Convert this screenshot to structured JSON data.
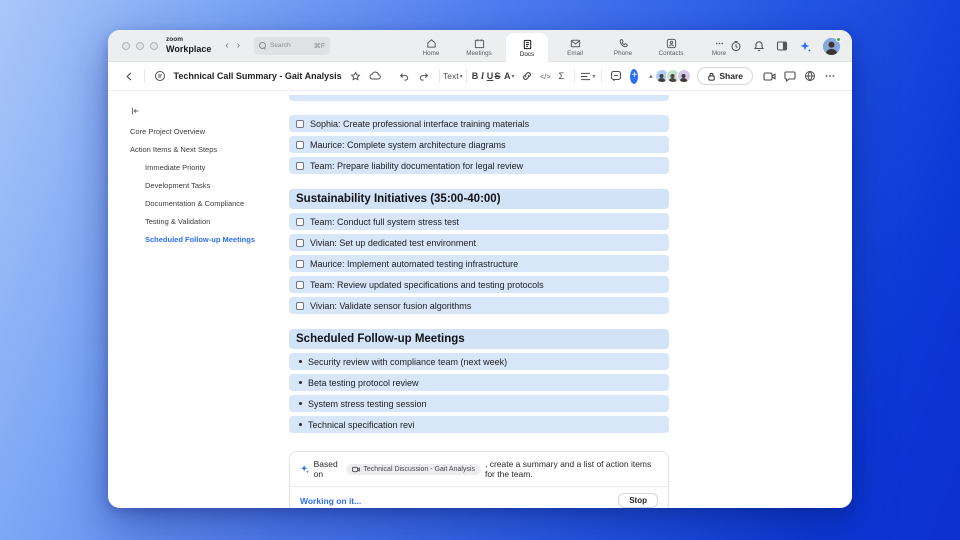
{
  "topbar": {
    "logo": {
      "line1": "zoom",
      "line2": "Workplace"
    },
    "search": {
      "placeholder": "Search",
      "shortcut": "⌘F"
    },
    "nav": [
      {
        "label": "Home"
      },
      {
        "label": "Meetings"
      },
      {
        "label": "Docs"
      },
      {
        "label": "Email"
      },
      {
        "label": "Phone"
      },
      {
        "label": "Contacts"
      },
      {
        "label": "More"
      }
    ]
  },
  "doc_toolbar": {
    "title": "Technical Call Summary - Gait Analysis",
    "text_dropdown": "Text",
    "bold": "B",
    "italic": "I",
    "underline": "U",
    "strike": "S",
    "color": "A",
    "code": "</>",
    "sigma": "Σ",
    "share_label": "Share"
  },
  "outline": {
    "items": [
      {
        "label": "Core Project Overview",
        "level": 1,
        "active": false
      },
      {
        "label": "Action Items & Next Steps",
        "level": 1,
        "active": false
      },
      {
        "label": "Immediate Priority",
        "level": 2,
        "active": false
      },
      {
        "label": "Development Tasks",
        "level": 2,
        "active": false
      },
      {
        "label": "Documentation & Compliance",
        "level": 2,
        "active": false
      },
      {
        "label": "Testing & Validation",
        "level": 2,
        "active": false
      },
      {
        "label": "Scheduled Follow-up Meetings",
        "level": 2,
        "active": true
      }
    ]
  },
  "document": {
    "checklist_top": {
      "items": [
        "Sophia: Create professional interface training materials",
        "Maurice: Complete system architecture diagrams",
        "Team: Prepare liability documentation for legal review"
      ]
    },
    "heading_sustainability": "Sustainability Initiatives (35:00-40:00)",
    "checklist_sustainability": {
      "items": [
        "Team: Conduct full system stress test",
        "Vivian: Set up dedicated test environment",
        "Maurice: Implement automated testing infrastructure",
        "Team: Review updated specifications and testing protocols",
        "Vivian: Validate sensor fusion algorithms"
      ]
    },
    "heading_meetings": "Scheduled Follow-up Meetings",
    "bullets_meetings": {
      "items": [
        "Security review with compliance team (next week)",
        "Beta testing protocol review",
        "System stress testing session",
        "Technical specification revi"
      ]
    }
  },
  "ai_panel": {
    "prefix": "Based on",
    "source_doc": "Technical Discussion - Gait Analysis",
    "suffix": ", create a summary and a list of action items for the team.",
    "status": "Working on it...",
    "stop_label": "Stop"
  },
  "colors": {
    "accent": "#2e6ef5",
    "row_bg": "#d7e6f8",
    "heading_bg": "#d2e2f7",
    "status_green": "#27ae4e"
  }
}
